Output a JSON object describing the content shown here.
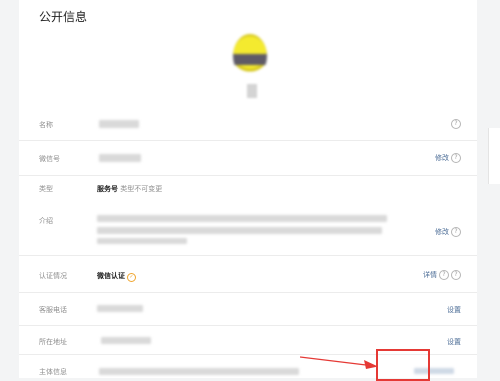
{
  "section_title": "公开信息",
  "rows": {
    "name": {
      "label": "名称"
    },
    "wechat_id": {
      "label": "微信号",
      "action": "修改"
    },
    "type": {
      "label": "类型",
      "value": "服务号",
      "note": "类型不可变更"
    },
    "intro": {
      "label": "介绍",
      "action": "修改"
    },
    "verify": {
      "label": "认证情况",
      "value": "微信认证",
      "action": "详情"
    },
    "phone": {
      "label": "客服电话",
      "action": "设置"
    },
    "address": {
      "label": "所在地址",
      "action": "设置"
    },
    "subject": {
      "label": "主体信息"
    }
  },
  "colors": {
    "link": "#4a6b95",
    "verified": "#f0a732",
    "highlight": "#e53935"
  },
  "icons": [
    "help-icon",
    "verified-check-icon",
    "red-arrow-annotation"
  ]
}
